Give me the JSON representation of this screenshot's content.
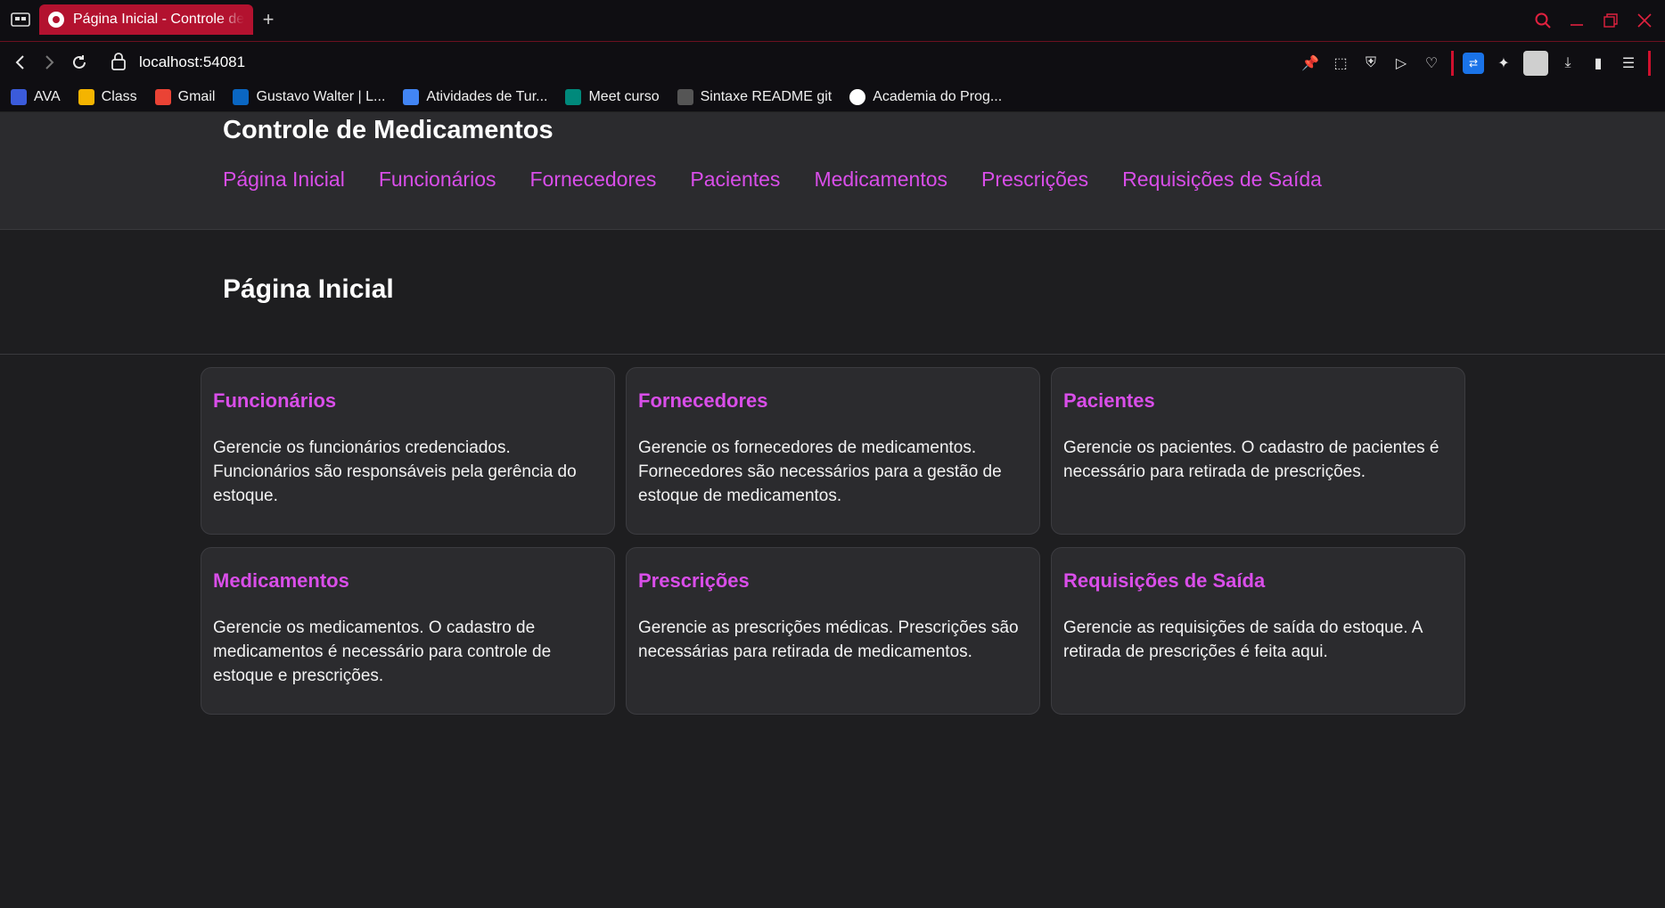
{
  "browser": {
    "tab_title": "Página Inicial - Controle de Medicamentos",
    "new_tab_label": "+",
    "url": "localhost:54081",
    "bookmarks": [
      {
        "label": "AVA",
        "icon": "ava-icon",
        "color": "#3b5bdb"
      },
      {
        "label": "Class",
        "icon": "google-classroom-icon",
        "color": "#f4b400"
      },
      {
        "label": "Gmail",
        "icon": "gmail-icon",
        "color": "#ea4335"
      },
      {
        "label": "Gustavo Walter | L...",
        "icon": "linkedin-icon",
        "color": "#0a66c2"
      },
      {
        "label": "Atividades de Tur...",
        "icon": "classroom-people-icon",
        "color": "#4285f4"
      },
      {
        "label": "Meet curso",
        "icon": "google-meet-icon",
        "color": "#00897b"
      },
      {
        "label": "Sintaxe README git",
        "icon": "markdown-icon",
        "color": "#555555"
      },
      {
        "label": "Academia do Prog...",
        "icon": "github-icon",
        "color": "#ffffff"
      }
    ]
  },
  "app": {
    "title": "Controle de Medicamentos",
    "nav": [
      "Página Inicial",
      "Funcionários",
      "Fornecedores",
      "Pacientes",
      "Medicamentos",
      "Prescrições",
      "Requisições de Saída"
    ],
    "page_heading": "Página Inicial",
    "cards": [
      {
        "title": "Funcionários",
        "text": "Gerencie os funcionários credenciados. Funcionários são responsáveis pela gerência do estoque."
      },
      {
        "title": "Fornecedores",
        "text": "Gerencie os fornecedores de medicamentos. Fornecedores são necessários para a gestão de estoque de medicamentos."
      },
      {
        "title": "Pacientes",
        "text": "Gerencie os pacientes. O cadastro de pacientes é necessário para retirada de prescrições."
      },
      {
        "title": "Medicamentos",
        "text": "Gerencie os medicamentos. O cadastro de medicamentos é necessário para controle de estoque e prescrições."
      },
      {
        "title": "Prescrições",
        "text": "Gerencie as prescrições médicas. Prescrições são necessárias para retirada de medicamentos."
      },
      {
        "title": "Requisições de Saída",
        "text": "Gerencie as requisições de saída do estoque. A retirada de prescrições é feita aqui."
      }
    ]
  },
  "colors": {
    "accent": "#d94ee9",
    "browser_accent": "#b3122f",
    "background": "#1e1e20",
    "surface": "#2b2b2e"
  }
}
